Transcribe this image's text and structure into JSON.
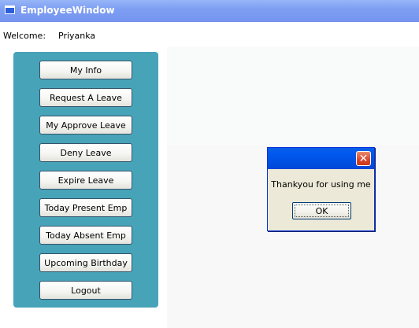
{
  "window": {
    "title": "EmployeeWindow"
  },
  "header": {
    "welcome_label": "Welcome:",
    "user_name": "Priyanka"
  },
  "sidebar": {
    "buttons": [
      "My Info",
      "Request A Leave",
      "My Approve Leave",
      "Deny Leave",
      "Expire Leave",
      "Today Present Emp",
      "Today Absent Emp",
      "Upcoming Birthday",
      "Logout"
    ]
  },
  "dialog": {
    "message": "Thankyou for using me",
    "ok_label": "OK",
    "close_glyph": "✕"
  },
  "icons": {
    "window_icon": "window-icon",
    "close_icon": "close-icon"
  },
  "colors": {
    "sidebar": "#47a3b8",
    "titlebar": "#7e9ef3",
    "dialog_title": "#0058ee",
    "close_button": "#d8472b"
  }
}
